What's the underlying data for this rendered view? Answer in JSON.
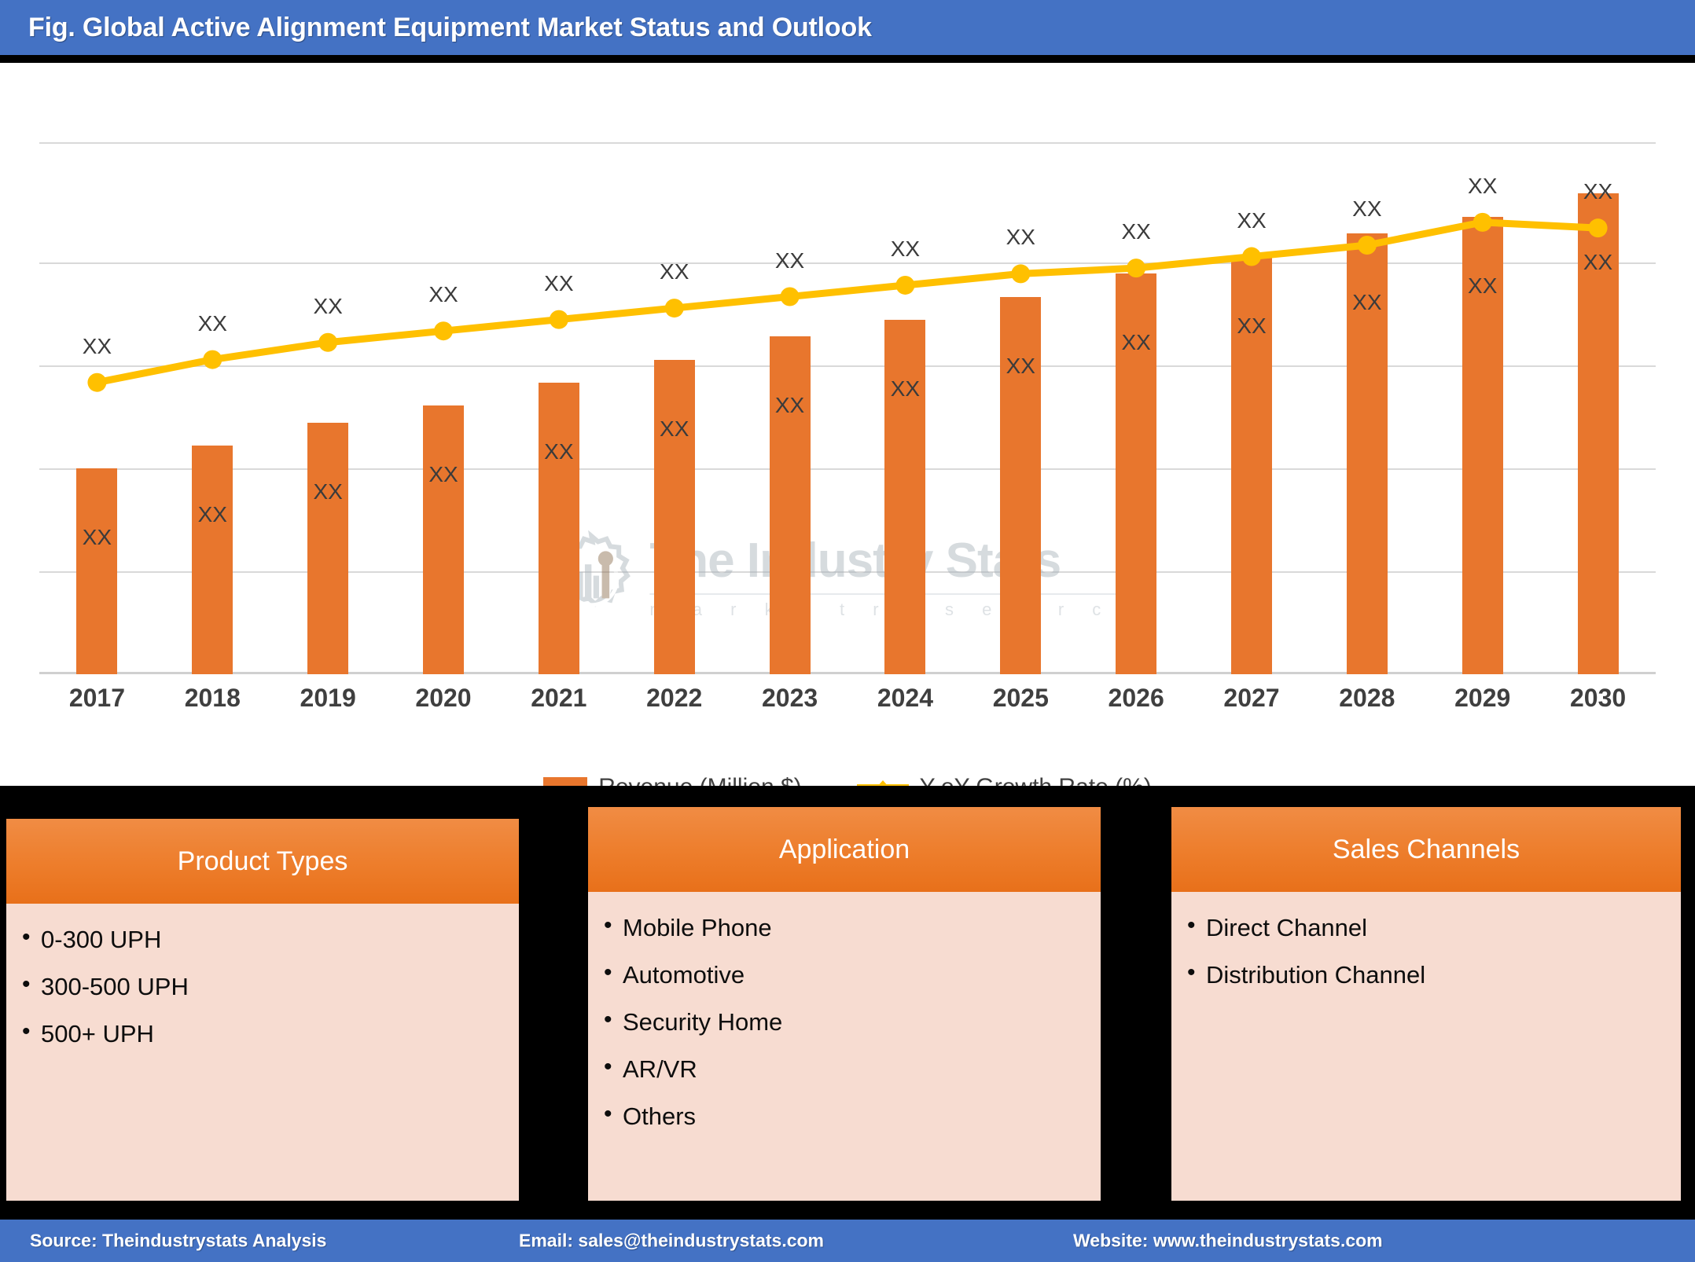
{
  "header": {
    "title": "Fig. Global Active Alignment Equipment Market Status and Outlook",
    "bar_color": "#4472C4"
  },
  "chart_data": {
    "type": "bar",
    "title": "Fig. Global Active Alignment Equipment Market Status and Outlook",
    "xlabel": "",
    "ylabel": "",
    "grid": true,
    "legend_position": "bottom",
    "categories": [
      "2017",
      "2018",
      "2019",
      "2020",
      "2021",
      "2022",
      "2023",
      "2024",
      "2025",
      "2026",
      "2027",
      "2028",
      "2029",
      "2030"
    ],
    "series": [
      {
        "name": "Revenue (Million $)",
        "type": "bar",
        "color": "#E8762D",
        "values": [
          36,
          40,
          44,
          47,
          51,
          55,
          59,
          62,
          66,
          70,
          73,
          77,
          80,
          84
        ],
        "data_labels": [
          "XX",
          "XX",
          "XX",
          "XX",
          "XX",
          "XX",
          "XX",
          "XX",
          "XX",
          "XX",
          "XX",
          "XX",
          "XX",
          "XX"
        ],
        "label_position": "inside"
      },
      {
        "name": "Y-oY Growth Rate (%)",
        "type": "line",
        "color": "#FFC000",
        "marker": "circle",
        "values": [
          51,
          55,
          58,
          60,
          62,
          64,
          66,
          68,
          70,
          71,
          73,
          75,
          79,
          78
        ],
        "data_labels": [
          "XX",
          "XX",
          "XX",
          "XX",
          "XX",
          "XX",
          "XX",
          "XX",
          "XX",
          "XX",
          "XX",
          "XX",
          "XX",
          "XX"
        ],
        "label_position": "above"
      }
    ],
    "ylim": [
      0,
      100
    ],
    "gridline_values": [
      93,
      72,
      54,
      36,
      18,
      0
    ]
  },
  "watermark": {
    "main": "The Industry Stats",
    "sub": "m a r k e t   r e s e a r c h"
  },
  "legend": {
    "revenue_label": "Revenue (Million $)",
    "growth_label": "Y-oY Growth Rate (%)"
  },
  "boxes": [
    {
      "title": "Product Types",
      "items": [
        "0-300 UPH",
        "300-500 UPH",
        "500+ UPH"
      ]
    },
    {
      "title": "Application",
      "items": [
        "Mobile Phone",
        "Automotive",
        "Security Home",
        "AR/VR",
        "Others"
      ]
    },
    {
      "title": "Sales Channels",
      "items": [
        "Direct Channel",
        "Distribution Channel"
      ]
    }
  ],
  "footer": {
    "source": "Source: Theindustrystats Analysis",
    "email": "Email: sales@theindustrystats.com",
    "website": "Website: www.theindustrystats.com"
  },
  "colors": {
    "accent_blue": "#4472C4",
    "bar_orange": "#E8762D",
    "line_yellow": "#FFC000",
    "box_body_pink": "#F7DCD1",
    "background_black": "#000000"
  }
}
